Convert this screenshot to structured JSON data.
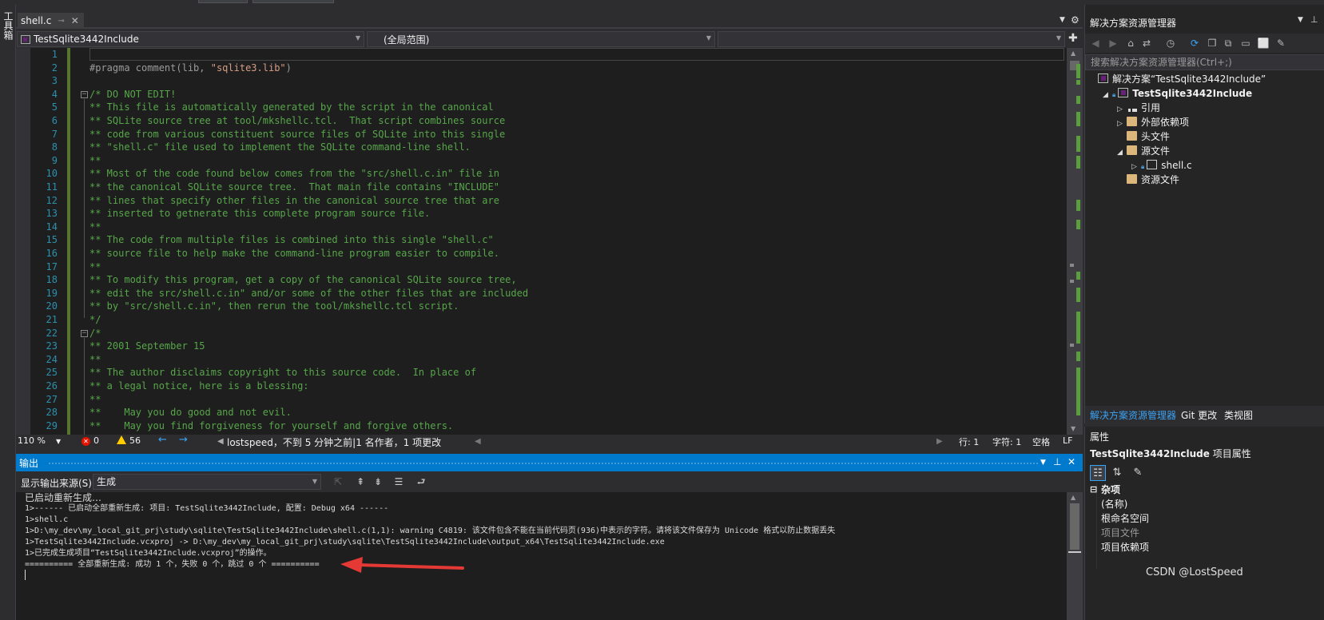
{
  "toolbox": {
    "label": "工具箱"
  },
  "editor_tab": {
    "title": "shell.c",
    "pin_icon": "pin-icon",
    "close_icon": "close-icon"
  },
  "nav": {
    "project": "TestSqlite3442Include",
    "scope": "(全局范围)",
    "member": ""
  },
  "code_lines": [
    {
      "n": "1",
      "text": "",
      "kind": "blank"
    },
    {
      "n": "2",
      "text": "#pragma comment(lib, ",
      "str": "\"sqlite3.lib\"",
      "tail": ")",
      "kind": "pp"
    },
    {
      "n": "3",
      "text": "",
      "kind": "blank"
    },
    {
      "n": "4",
      "text": "/* DO NOT EDIT!",
      "kind": "comment",
      "fold": true
    },
    {
      "n": "5",
      "text": "** This file is automatically generated by the script in the canonical",
      "kind": "comment"
    },
    {
      "n": "6",
      "text": "** SQLite source tree at tool/mkshellc.tcl.  That script combines source",
      "kind": "comment"
    },
    {
      "n": "7",
      "text": "** code from various constituent source files of SQLite into this single",
      "kind": "comment"
    },
    {
      "n": "8",
      "text": "** \"shell.c\" file used to implement the SQLite command-line shell.",
      "kind": "comment"
    },
    {
      "n": "9",
      "text": "**",
      "kind": "comment"
    },
    {
      "n": "10",
      "text": "** Most of the code found below comes from the \"src/shell.c.in\" file in",
      "kind": "comment"
    },
    {
      "n": "11",
      "text": "** the canonical SQLite source tree.  That main file contains \"INCLUDE\"",
      "kind": "comment"
    },
    {
      "n": "12",
      "text": "** lines that specify other files in the canonical source tree that are",
      "kind": "comment"
    },
    {
      "n": "13",
      "text": "** inserted to getnerate this complete program source file.",
      "kind": "comment"
    },
    {
      "n": "14",
      "text": "**",
      "kind": "comment"
    },
    {
      "n": "15",
      "text": "** The code from multiple files is combined into this single \"shell.c\"",
      "kind": "comment"
    },
    {
      "n": "16",
      "text": "** source file to help make the command-line program easier to compile.",
      "kind": "comment"
    },
    {
      "n": "17",
      "text": "**",
      "kind": "comment"
    },
    {
      "n": "18",
      "text": "** To modify this program, get a copy of the canonical SQLite source tree,",
      "kind": "comment"
    },
    {
      "n": "19",
      "text": "** edit the src/shell.c.in\" and/or some of the other files that are included",
      "kind": "comment"
    },
    {
      "n": "20",
      "text": "** by \"src/shell.c.in\", then rerun the tool/mkshellc.tcl script.",
      "kind": "comment"
    },
    {
      "n": "21",
      "text": "*/",
      "kind": "comment"
    },
    {
      "n": "22",
      "text": "/*",
      "kind": "comment",
      "fold": true
    },
    {
      "n": "23",
      "text": "** 2001 September 15",
      "kind": "comment"
    },
    {
      "n": "24",
      "text": "**",
      "kind": "comment"
    },
    {
      "n": "25",
      "text": "** The author disclaims copyright to this source code.  In place of",
      "kind": "comment"
    },
    {
      "n": "26",
      "text": "** a legal notice, here is a blessing:",
      "kind": "comment"
    },
    {
      "n": "27",
      "text": "**",
      "kind": "comment"
    },
    {
      "n": "28",
      "text": "**    May you do good and not evil.",
      "kind": "comment"
    },
    {
      "n": "29",
      "text": "**    May you find forgiveness for yourself and forgive others.",
      "kind": "comment"
    }
  ],
  "editor_status": {
    "zoom": "110 %",
    "errors": "0",
    "warnings": "56",
    "git_info": "lostspeed，不到 5 分钟之前|1 名作者，1 项更改",
    "line": "行: 1",
    "col": "字符: 1",
    "whitespace": "空格",
    "eol": "LF"
  },
  "output": {
    "title": "输出",
    "source_label": "显示输出来源(S):",
    "source_value": "生成",
    "lines": [
      "已启动重新生成…",
      "1>------ 已启动全部重新生成: 项目: TestSqlite3442Include, 配置: Debug x64 ------",
      "1>shell.c",
      "1>D:\\my_dev\\my_local_git_prj\\study\\sqlite\\TestSqlite3442Include\\shell.c(1,1): warning C4819: 该文件包含不能在当前代码页(936)中表示的字符。请将该文件保存为 Unicode 格式以防止数据丢失",
      "1>TestSqlite3442Include.vcxproj -> D:\\my_dev\\my_local_git_prj\\study\\sqlite\\TestSqlite3442Include\\output_x64\\TestSqlite3442Include.exe",
      "1>已完成生成项目“TestSqlite3442Include.vcxproj”的操作。",
      "========== 全部重新生成: 成功 1 个，失败 0 个，跳过 0 个 =========="
    ]
  },
  "solution_explorer": {
    "title": "解决方案资源管理器",
    "search_placeholder": "搜索解决方案资源管理器(Ctrl+;)",
    "tree": [
      {
        "label": "解决方案“TestSqlite3442Include”",
        "indent": 0,
        "twisty": "",
        "icon": "solution-icon",
        "bold": false
      },
      {
        "label": "TestSqlite3442Include",
        "indent": 1,
        "twisty": "◢",
        "icon": "project-icon",
        "bold": true,
        "lock": true
      },
      {
        "label": "引用",
        "indent": 2,
        "twisty": "▷",
        "icon": "references-icon",
        "bold": false
      },
      {
        "label": "外部依赖项",
        "indent": 2,
        "twisty": "▷",
        "icon": "external-deps-icon",
        "bold": false
      },
      {
        "label": "头文件",
        "indent": 2,
        "twisty": "",
        "icon": "folder-icon",
        "bold": false
      },
      {
        "label": "源文件",
        "indent": 2,
        "twisty": "◢",
        "icon": "folder-icon",
        "bold": false
      },
      {
        "label": "shell.c",
        "indent": 3,
        "twisty": "▷",
        "icon": "c-file-icon",
        "bold": false,
        "lock": true
      },
      {
        "label": "资源文件",
        "indent": 2,
        "twisty": "",
        "icon": "folder-icon",
        "bold": false
      }
    ],
    "tabs": [
      "解决方案资源管理器",
      "Git 更改",
      "类视图"
    ]
  },
  "properties": {
    "title": "属性",
    "object_name": "TestSqlite3442Include",
    "object_type": "项目属性",
    "category": "杂项",
    "rows": [
      "(名称)",
      "根命名空间",
      "项目文件",
      "项目依赖项"
    ]
  },
  "watermark": "CSDN @LostSpeed",
  "colors": {
    "accent": "#007acc",
    "comment": "#57a64a",
    "line_number": "#2b91af",
    "arrow": "#e53935"
  }
}
